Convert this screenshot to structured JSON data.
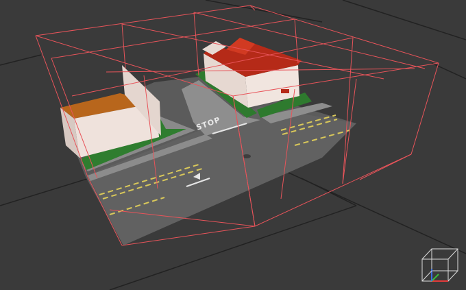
{
  "viewport": {
    "road_marking_text": "STOP",
    "colors": {
      "background": "#3a3a3a",
      "ground_lines": "#222222",
      "bounding_grid": "#e8545a",
      "asphalt": "#5f5f5f",
      "sidewalk": "#8e8e8e",
      "grass": "#2f7d2f",
      "building_wall": "#efe2dc",
      "roof_red": "#c1321d",
      "flat_roof_orange": "#b8661c",
      "lane_marking_yellow": "#d9c85a",
      "lane_marking_white": "#e6e6e6"
    }
  },
  "nav_cube": {
    "icon": "view-cube-gizmo",
    "axis_colors": {
      "x": "#e23b3b",
      "y": "#3bbf3b",
      "z": "#3b6fe2"
    }
  }
}
